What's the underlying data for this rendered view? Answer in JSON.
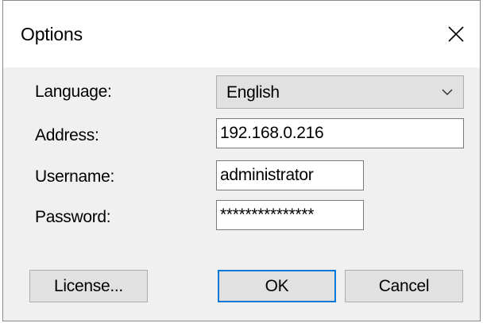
{
  "dialog": {
    "title": "Options"
  },
  "form": {
    "language_label": "Language:",
    "language_value": "English",
    "address_label": "Address:",
    "address_value": "192.168.0.216",
    "username_label": "Username:",
    "username_value": "administrator",
    "password_label": "Password:",
    "password_value": "***************"
  },
  "buttons": {
    "license_label": "License...",
    "ok_label": "OK",
    "cancel_label": "Cancel"
  },
  "colors": {
    "dialog_background": "#f0f0f0",
    "titlebar_background": "#ffffff",
    "button_background": "#e1e1e1",
    "focus_accent": "#0078d7"
  },
  "icons": {
    "close": "close-icon",
    "dropdown": "chevron-down-icon"
  }
}
